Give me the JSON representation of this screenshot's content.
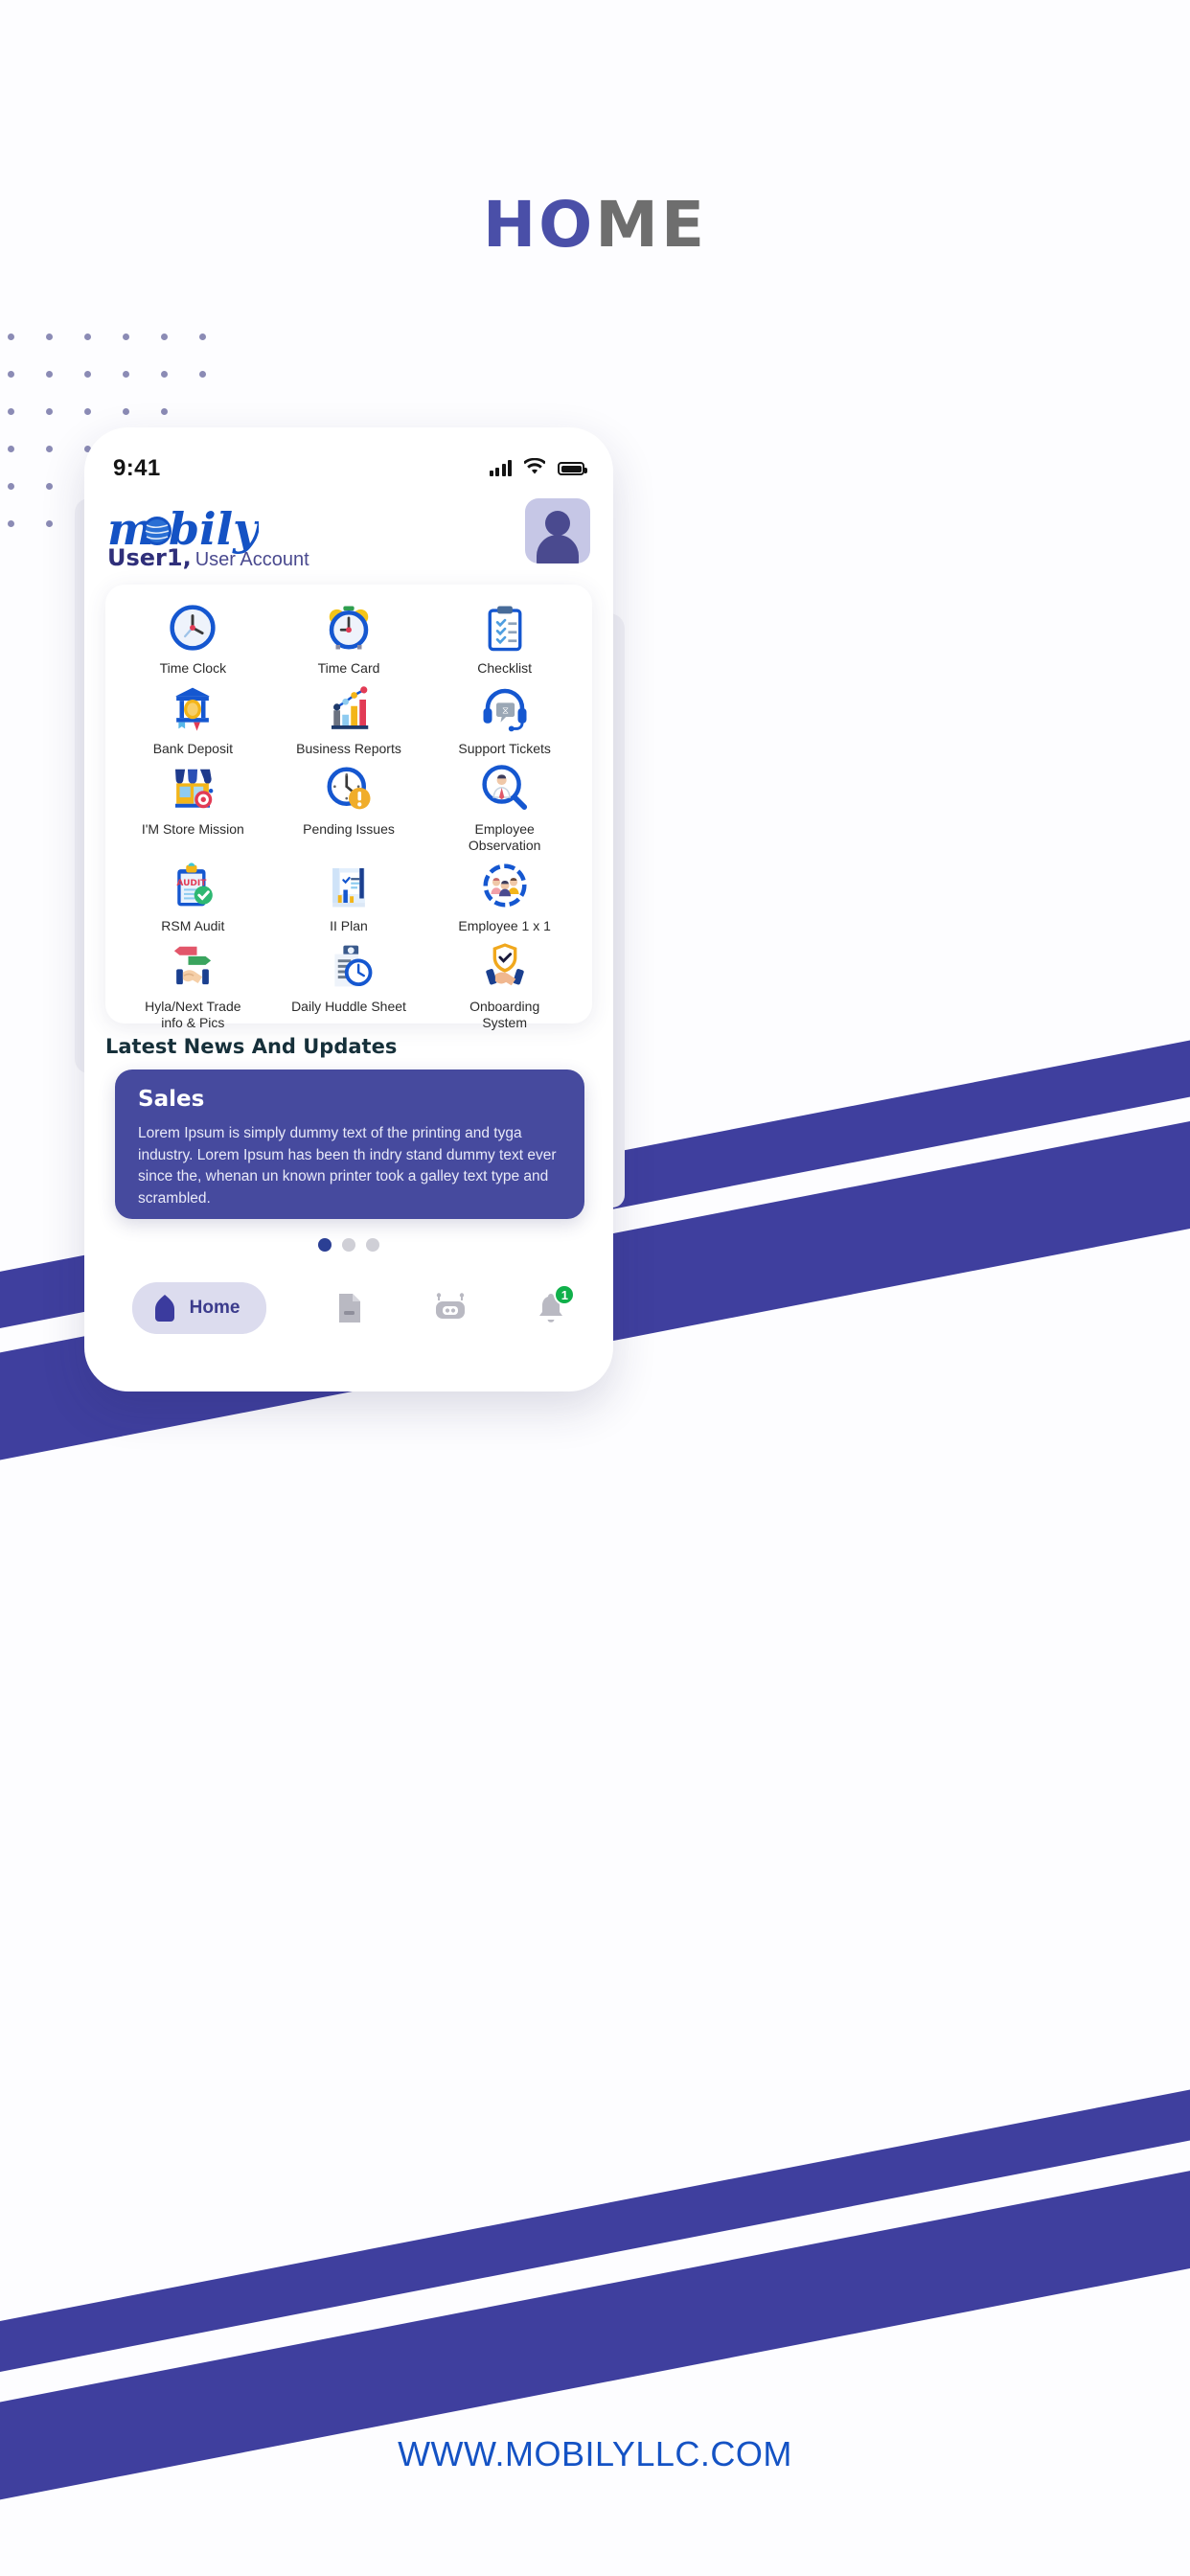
{
  "page": {
    "title_part_blue": "HO",
    "title_part_gray": "ME",
    "footer_url": "WWW.MOBILYLLC.COM",
    "accent_blue": "#464a9e",
    "accent_gray": "#6e6e6e",
    "brand_blue": "#1452c4",
    "badge_green": "#10b04a"
  },
  "statusbar": {
    "time": "9:41",
    "signal_icon": "signal-bars-icon",
    "wifi_icon": "wifi-icon",
    "battery_icon": "battery-icon"
  },
  "header": {
    "logo_text": "mobily",
    "user_name": "User1,",
    "user_role": "User Account",
    "avatar_icon": "avatar-icon"
  },
  "apps": [
    {
      "label": "Time Clock",
      "icon": "clock-icon"
    },
    {
      "label": "Time Card",
      "icon": "alarm-clock-icon"
    },
    {
      "label": "Checklist",
      "icon": "clipboard-check-icon"
    },
    {
      "label": "Bank Deposit",
      "icon": "bank-icon"
    },
    {
      "label": "Business Reports",
      "icon": "bar-chart-icon"
    },
    {
      "label": "Support Tickets",
      "icon": "headset-icon"
    },
    {
      "label": "I'M Store Mission",
      "icon": "storefront-target-icon"
    },
    {
      "label": "Pending Issues",
      "icon": "clock-alert-icon"
    },
    {
      "label": "Employee Observation",
      "icon": "magnifier-person-icon"
    },
    {
      "label": "RSM Audit",
      "icon": "audit-clipboard-icon"
    },
    {
      "label": "II Plan",
      "icon": "plan-chart-icon"
    },
    {
      "label": "Employee 1 x 1",
      "icon": "team-gear-icon"
    },
    {
      "label": "Hyla/Next Trade info & Pics",
      "icon": "trade-handshake-icon"
    },
    {
      "label": "Daily Huddle Sheet",
      "icon": "huddle-sheet-icon"
    },
    {
      "label": "Onboarding System",
      "icon": "shield-handshake-icon"
    }
  ],
  "news": {
    "section_title": "Latest News And Updates",
    "card_title": "Sales",
    "card_body": "Lorem Ipsum is simply dummy text of the printing and tyga industry. Lorem Ipsum has been th indry stand dummy text ever since the, whenan un known printer took a galley text type and scrambled.",
    "pager": {
      "total": 3,
      "active_index": 0
    }
  },
  "bottom_nav": [
    {
      "label": "Home",
      "icon": "home-icon",
      "active": true,
      "badge": ""
    },
    {
      "label": "",
      "icon": "document-icon",
      "active": false,
      "badge": ""
    },
    {
      "label": "",
      "icon": "robot-icon",
      "active": false,
      "badge": ""
    },
    {
      "label": "",
      "icon": "bell-icon",
      "active": false,
      "badge": "1"
    }
  ]
}
